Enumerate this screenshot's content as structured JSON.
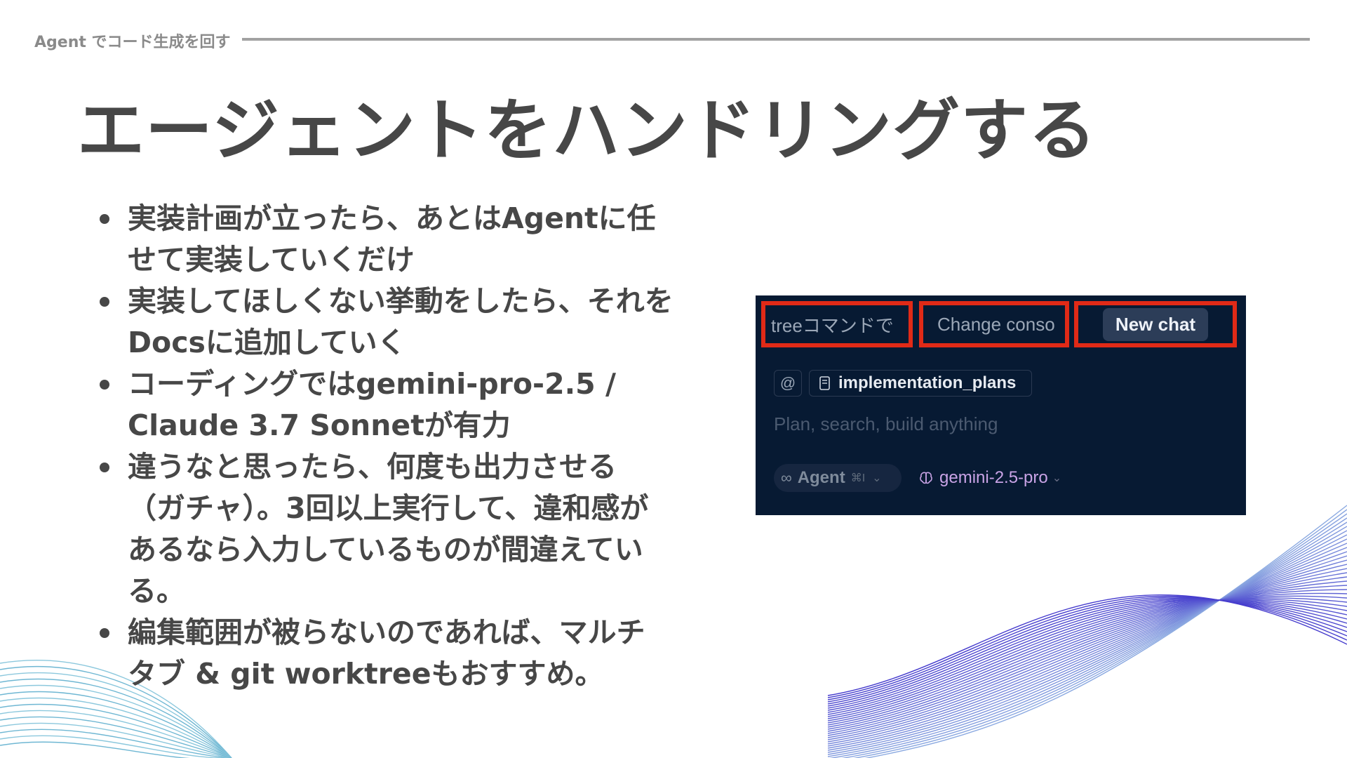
{
  "slide": {
    "section_label": "Agent でコード生成を回す",
    "title": "エージェントをハンドリングする",
    "bullets": [
      "実装計画が立ったら、あとはAgentに任せて実装していくだけ",
      "実装してほしくない挙動をしたら、それをDocsに追加していく",
      "コーディングではgemini-pro-2.5 / Claude 3.7 Sonnetが有力",
      "違うなと思ったら、何度も出力させる（ガチャ）。3回以上実行して、違和感があるなら入力しているものが間違えている。",
      "編集範囲が被らないのであれば、マルチタブ & git worktreeもおすすめ。"
    ]
  },
  "screenshot": {
    "tabs": [
      {
        "label": "treeコマンドで"
      },
      {
        "label": "Change conso"
      },
      {
        "label": "New chat"
      }
    ],
    "highlight_color": "#e12a17",
    "at_symbol": "@",
    "context_chip": "implementation_plans",
    "placeholder": "Plan, search, build anything",
    "agent_mode": {
      "label": "Agent",
      "shortcut": "⌘I"
    },
    "model": "gemini-2.5-pro"
  }
}
